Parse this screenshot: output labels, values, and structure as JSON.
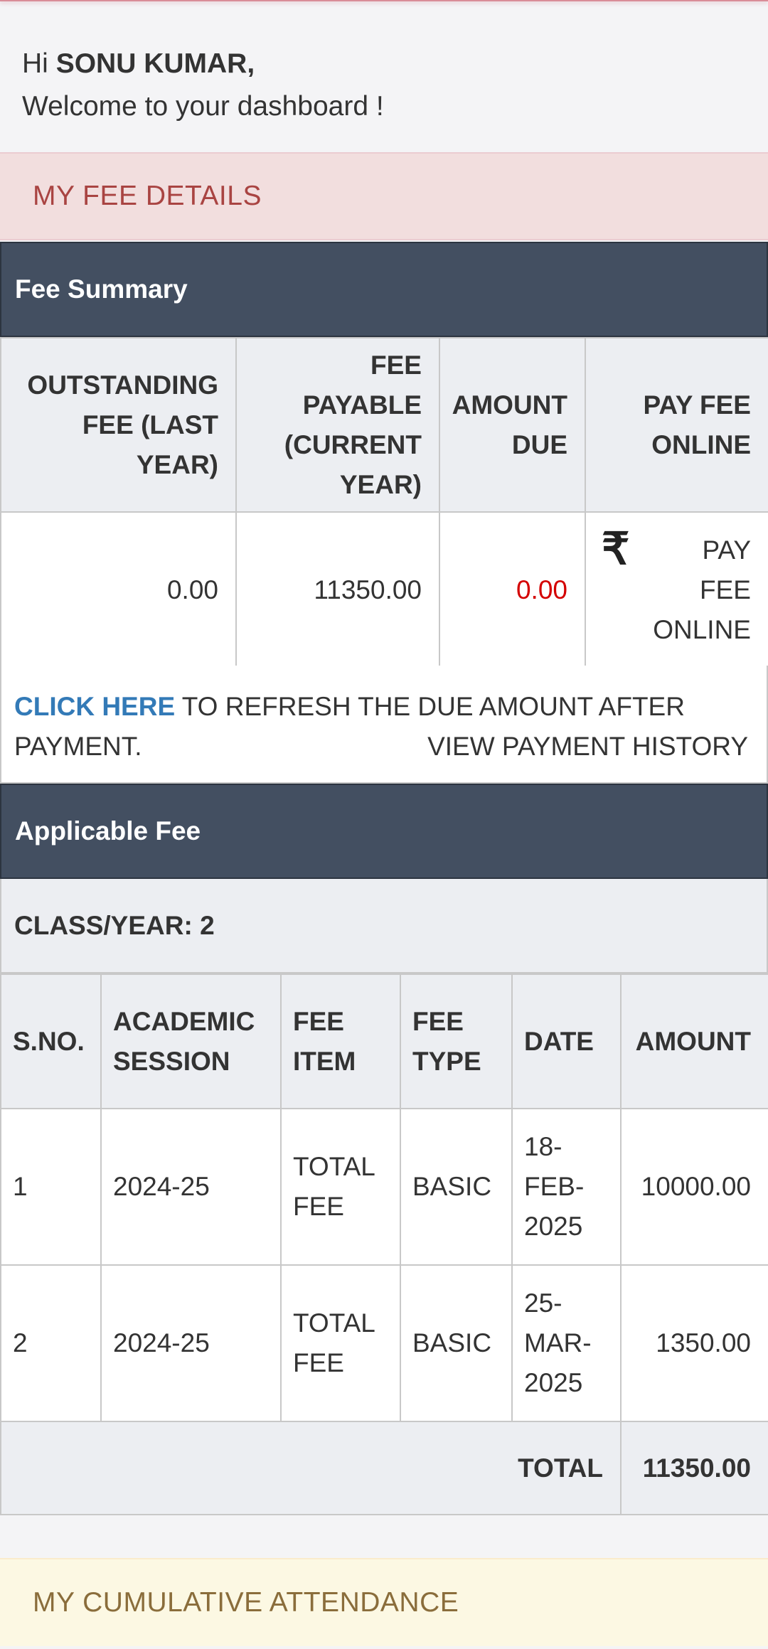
{
  "greeting": {
    "hi": "Hi",
    "name": "SONU KUMAR,",
    "welcome": "Welcome to your dashboard !"
  },
  "fee_section": {
    "title": "MY FEE DETAILS"
  },
  "fee_summary": {
    "title": "Fee Summary",
    "headers": [
      "OUTSTANDING FEE (LAST YEAR)",
      "FEE PAYABLE (CURRENT YEAR)",
      "AMOUNT DUE",
      "PAY FEE ONLINE"
    ],
    "outstanding": "0.00",
    "payable": "11350.00",
    "due": "0.00",
    "pay_symbol": "₹",
    "pay_label": "PAY FEE ONLINE",
    "refresh_link": "CLICK HERE",
    "refresh_text": "TO REFRESH THE DUE AMOUNT AFTER PAYMENT.",
    "history_link": "VIEW PAYMENT HISTORY"
  },
  "applicable_fee": {
    "title": "Applicable Fee",
    "class_year": "CLASS/YEAR: 2",
    "headers": [
      "S.NO.",
      "ACADEMIC SESSION",
      "FEE ITEM",
      "FEE TYPE",
      "DATE",
      "AMOUNT"
    ],
    "rows": [
      {
        "sno": "1",
        "session": "2024-25",
        "item": "TOTAL FEE",
        "type": "BASIC",
        "date": "18-FEB-2025",
        "amount": "10000.00"
      },
      {
        "sno": "2",
        "session": "2024-25",
        "item": "TOTAL FEE",
        "type": "BASIC",
        "date": "25-MAR-2025",
        "amount": "1350.00"
      }
    ],
    "total_label": "TOTAL",
    "total_value": "11350.00"
  },
  "attendance_section": {
    "title": "MY CUMULATIVE ATTENDANCE"
  },
  "colors": {
    "panel_header": "#434f61",
    "fee_bar_bg": "#f2dede",
    "fee_bar_text": "#a94442",
    "attendance_bg": "#fcf8e3",
    "attendance_text": "#8a6d3b",
    "link": "#337ab7",
    "due_red": "#d40000"
  }
}
